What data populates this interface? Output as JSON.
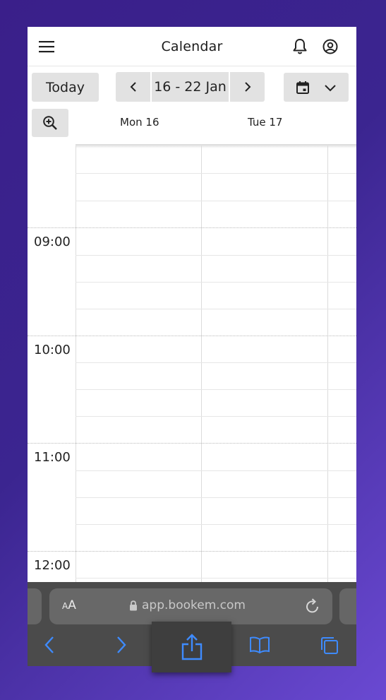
{
  "app": {
    "title": "Calendar"
  },
  "toolbar": {
    "today_label": "Today",
    "date_range": "16 - 22 Jan"
  },
  "days": [
    {
      "label": "Mon 16"
    },
    {
      "label": "Tue 17"
    }
  ],
  "times": [
    "09:00",
    "10:00",
    "11:00",
    "12:00"
  ],
  "browser": {
    "text_size_label_small": "A",
    "text_size_label_large": "A",
    "url": "app.bookem.com"
  },
  "colors": {
    "accent": "#3e8bff",
    "background_gradient_start": "#3a1f8a",
    "background_gradient_end": "#6a49d2",
    "button_bg": "#e2e2e2"
  }
}
